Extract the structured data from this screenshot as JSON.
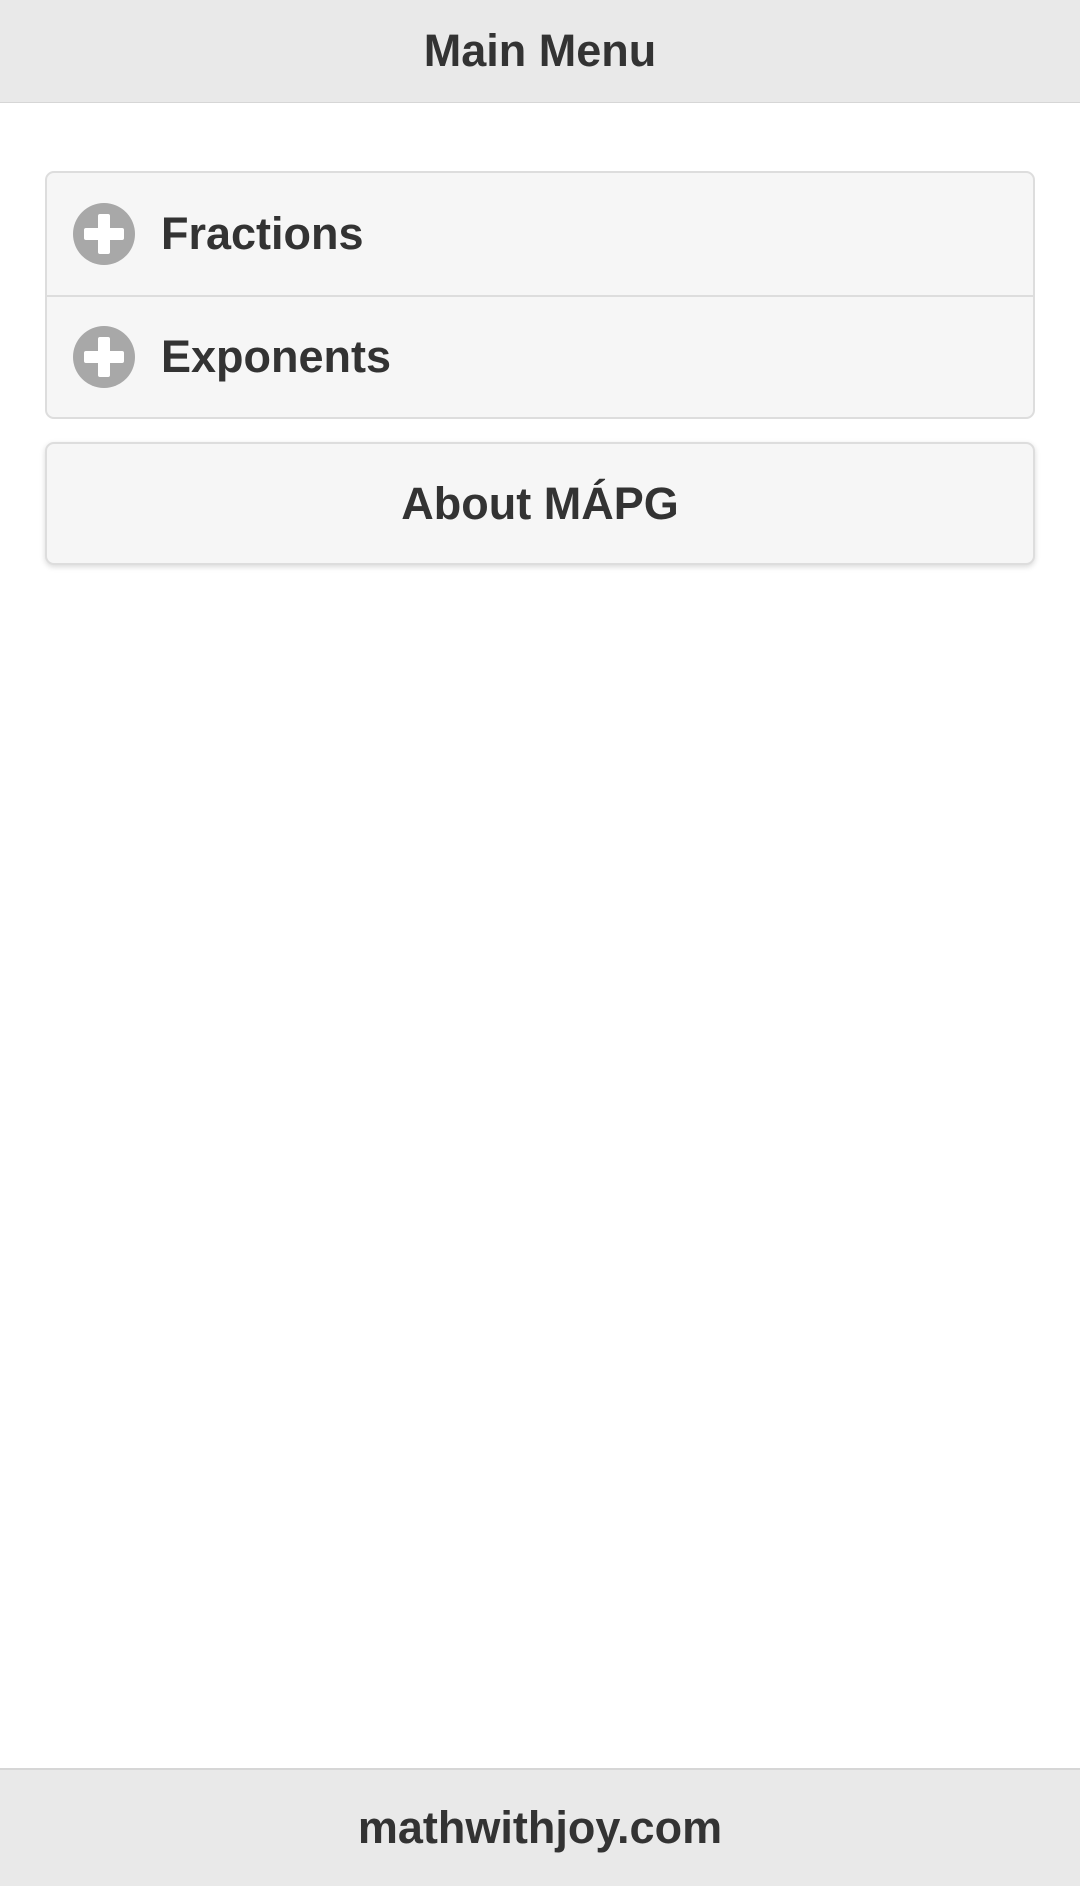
{
  "header": {
    "title": "Main Menu"
  },
  "menu": {
    "items": [
      {
        "label": "Fractions",
        "icon": "plus-circle-icon"
      },
      {
        "label": "Exponents",
        "icon": "plus-circle-icon"
      }
    ]
  },
  "about": {
    "label": "About MÁPG"
  },
  "footer": {
    "text": "mathwithjoy.com"
  },
  "colors": {
    "header_bg": "#e9e9e9",
    "item_bg": "#f6f6f6",
    "icon_bg": "#a8a8a8",
    "text": "#333333"
  }
}
